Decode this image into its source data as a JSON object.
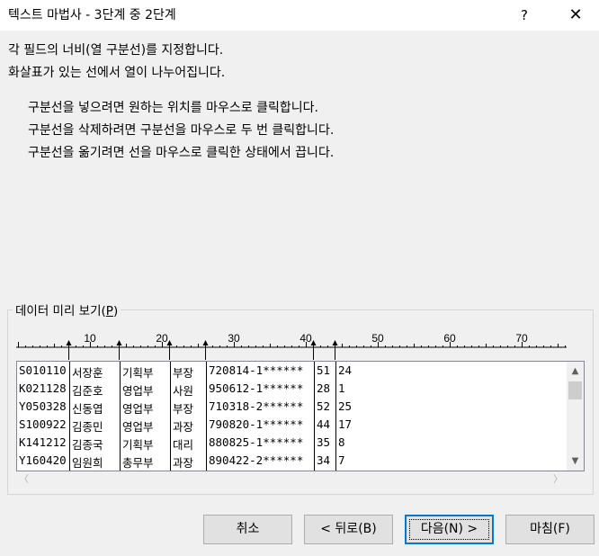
{
  "window": {
    "title": "텍스트 마법사 - 3단계 중 2단계",
    "help": "?",
    "close": "✕"
  },
  "instructions": {
    "line1": "각 필드의 너비(열 구분선)를 지정합니다.",
    "line2": "화살표가 있는 선에서 열이 나누어집니다.",
    "bullet1": "구분선을 넣으려면 원하는 위치를 마우스로 클릭합니다.",
    "bullet2": "구분선을 삭제하려면 구분선을 마우스로 두 번 클릭합니다.",
    "bullet3": "구분선을 옮기려면 선을 마우스로 클릭한 상태에서 끕니다."
  },
  "preview": {
    "label": "데이터 미리 보기(",
    "label_key": "P",
    "label_end": ")",
    "ruler_labels": [
      "10",
      "20",
      "30",
      "40",
      "50",
      "60",
      "70"
    ],
    "rows": [
      [
        "S010110",
        "서장훈",
        "기획부",
        "부장",
        "720814-1******",
        "51",
        "24"
      ],
      [
        "K021128",
        "김준호",
        "영업부",
        "사원",
        "950612-1******",
        "28",
        "1"
      ],
      [
        "Y050328",
        "신동엽",
        "영업부",
        "부장",
        "710318-2******",
        "52",
        "25"
      ],
      [
        "S100922",
        "김종민",
        "영업부",
        "과장",
        "790820-1******",
        "44",
        "17"
      ],
      [
        "K141212",
        "김종국",
        "기획부",
        "대리",
        "880825-1******",
        "35",
        "8"
      ],
      [
        "Y160420",
        "임원희",
        "총무부",
        "과장",
        "890422-2******",
        "34",
        "7"
      ]
    ]
  },
  "buttons": {
    "cancel": "취소",
    "back": "< 뒤로(B)",
    "next": "다음(N) >",
    "finish": "마침(F)"
  },
  "colors": {
    "accent": "#0078d7",
    "background": "#f0f0f0"
  }
}
